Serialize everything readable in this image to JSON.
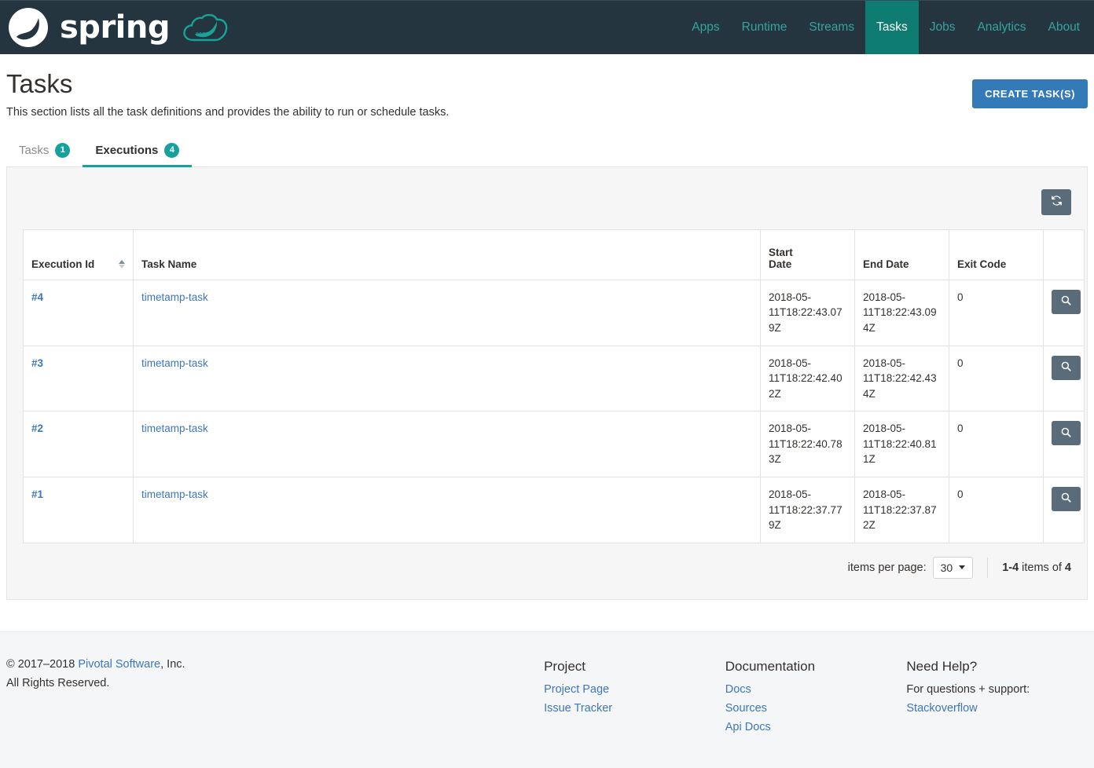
{
  "navbar": {
    "brand_word": "spring",
    "brand_logo_name": "spring-leaf-logo",
    "brand_cloud_name": "spring-cloud-logo",
    "links": [
      {
        "label": "Apps",
        "active": false
      },
      {
        "label": "Runtime",
        "active": false
      },
      {
        "label": "Streams",
        "active": false
      },
      {
        "label": "Tasks",
        "active": true
      },
      {
        "label": "Jobs",
        "active": false
      },
      {
        "label": "Analytics",
        "active": false
      },
      {
        "label": "About",
        "active": false
      }
    ],
    "bg_color": "#24353f",
    "link_color": "#34a4a0",
    "active_bg_color": "#0f7c72"
  },
  "header": {
    "title": "Tasks",
    "description": "This section lists all the task definitions and provides the ability to run or schedule tasks.",
    "create_button_label": "CREATE TASK(S)",
    "create_button_color": "#337ab7"
  },
  "tabs": [
    {
      "label": "Tasks",
      "badge": "1",
      "active": false
    },
    {
      "label": "Executions",
      "badge": "4",
      "active": true
    }
  ],
  "tabs_accent_color": "#16a19c",
  "toolbar": {
    "refresh_icon": "refresh-icon",
    "refresh_title": "Refresh"
  },
  "table": {
    "columns": [
      {
        "label": "Execution Id",
        "sortable": true
      },
      {
        "label": "Task Name",
        "sortable": false
      },
      {
        "label": "Start\nDate",
        "line1": "Start",
        "line2": "Date",
        "sortable": false
      },
      {
        "label": "End Date",
        "sortable": false
      },
      {
        "label": "Exit Code",
        "sortable": false
      },
      {
        "label": "",
        "sortable": false
      }
    ],
    "rows": [
      {
        "execution_id": "#4",
        "task_name": "timetamp-task",
        "start_date": "2018-05-11T18:22:43.079Z",
        "end_date": "2018-05-11T18:22:43.094Z",
        "exit_code": "0",
        "action_icon": "magnifier-icon"
      },
      {
        "execution_id": "#3",
        "task_name": "timetamp-task",
        "start_date": "2018-05-11T18:22:42.402Z",
        "end_date": "2018-05-11T18:22:42.434Z",
        "exit_code": "0",
        "action_icon": "magnifier-icon"
      },
      {
        "execution_id": "#2",
        "task_name": "timetamp-task",
        "start_date": "2018-05-11T18:22:40.783Z",
        "end_date": "2018-05-11T18:22:40.811Z",
        "exit_code": "0",
        "action_icon": "magnifier-icon"
      },
      {
        "execution_id": "#1",
        "task_name": "timetamp-task",
        "start_date": "2018-05-11T18:22:37.779Z",
        "end_date": "2018-05-11T18:22:37.872Z",
        "exit_code": "0",
        "action_icon": "magnifier-icon"
      }
    ]
  },
  "pagination": {
    "items_per_page_label": "items per page:",
    "items_per_page_value": "30",
    "range": "1-4",
    "middle_text": "items of",
    "total": "4"
  },
  "footer": {
    "copyright_prefix": "© 2017–2018 ",
    "copyright_link": "Pivotal Software",
    "copyright_suffix": ", Inc.",
    "rights": "All Rights Reserved.",
    "columns": [
      {
        "title": "Project",
        "links": [
          "Project Page",
          "Issue Tracker"
        ],
        "static": []
      },
      {
        "title": "Documentation",
        "links": [
          "Docs",
          "Sources",
          "Api Docs"
        ],
        "static": []
      },
      {
        "title": "Need Help?",
        "links": [
          "Stackoverflow"
        ],
        "static": [
          "For questions + support:"
        ]
      }
    ]
  }
}
